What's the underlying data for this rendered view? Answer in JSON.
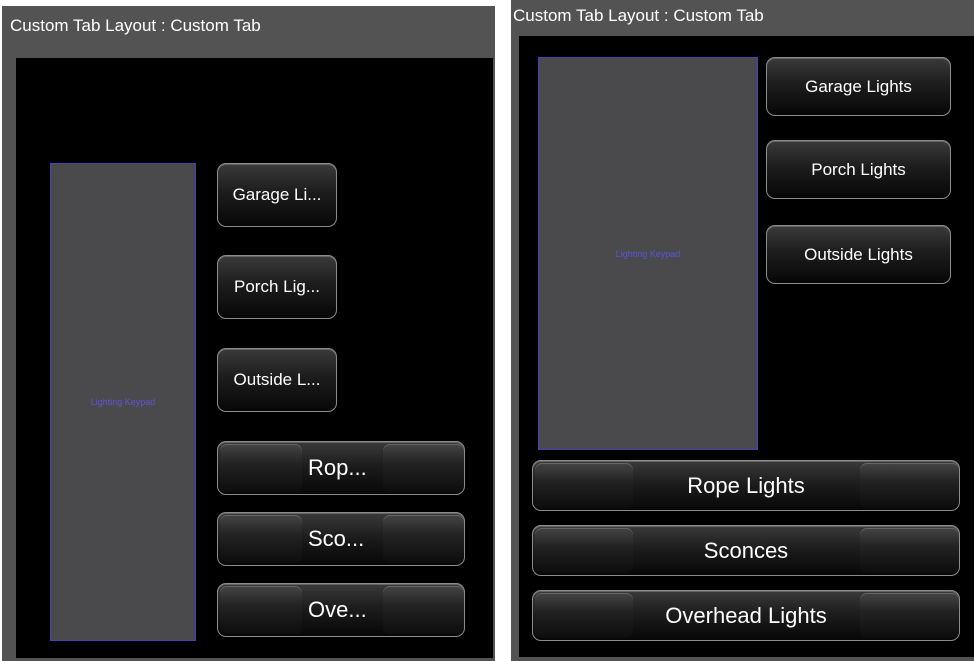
{
  "left_panel": {
    "title": "Custom Tab Layout : Custom Tab",
    "keypad_label": "Lighting Keypad",
    "buttons": [
      "Garage Li...",
      "Porch Lig...",
      "Outside L..."
    ],
    "wide_buttons": [
      "Rop...",
      "Sco...",
      "Ove..."
    ]
  },
  "right_panel": {
    "title": "Custom Tab Layout : Custom Tab",
    "keypad_label": "Lighting Keypad",
    "buttons": [
      "Garage Lights",
      "Porch Lights",
      "Outside Lights"
    ],
    "wide_buttons": [
      "Rope Lights",
      "Sconces",
      "Overhead Lights"
    ]
  },
  "colors": {
    "panel": "#535353",
    "canvas": "#000000",
    "keypad_fill": "#4a494b",
    "keypad_border": "#4542b8",
    "keypad_text": "#5b56d6",
    "button_text": "#ffffff"
  }
}
